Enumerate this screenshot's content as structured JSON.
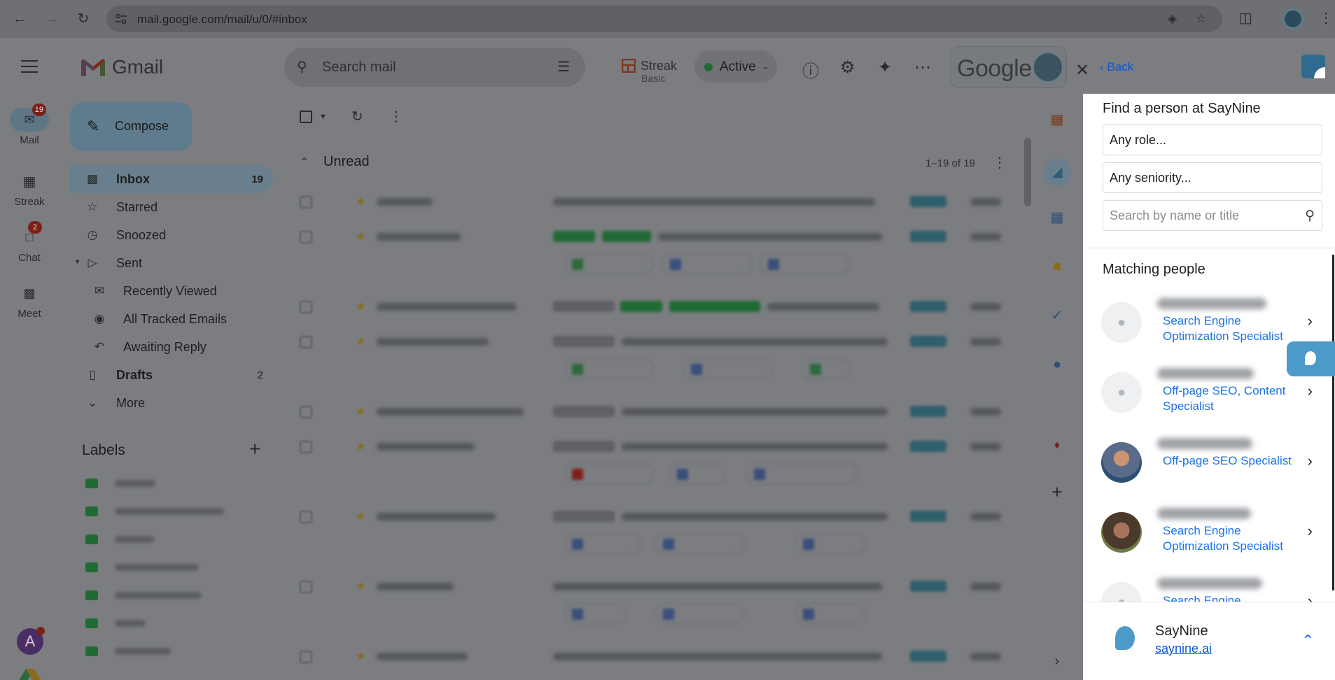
{
  "browser": {
    "url": "mail.google.com/mail/u/0/#inbox"
  },
  "rail": {
    "mail": {
      "label": "Mail",
      "badge": "19"
    },
    "streak": {
      "label": "Streak"
    },
    "chat": {
      "label": "Chat",
      "badge": "2"
    },
    "meet": {
      "label": "Meet"
    },
    "account_initial": "A"
  },
  "header": {
    "app_name": "Gmail",
    "search_placeholder": "Search mail",
    "streak_name": "Streak",
    "streak_plan": "Basic",
    "status": "Active",
    "google_label": "Google"
  },
  "sidebar": {
    "compose": "Compose",
    "items": [
      {
        "label": "Inbox",
        "count": "19"
      },
      {
        "label": "Starred",
        "count": ""
      },
      {
        "label": "Snoozed",
        "count": ""
      },
      {
        "label": "Sent",
        "count": ""
      },
      {
        "label": "Recently Viewed",
        "count": ""
      },
      {
        "label": "All Tracked Emails",
        "count": ""
      },
      {
        "label": "Awaiting Reply",
        "count": ""
      },
      {
        "label": "Drafts",
        "count": "2"
      },
      {
        "label": "More",
        "count": ""
      }
    ],
    "labels_title": "Labels"
  },
  "inbox": {
    "section_title": "Unread",
    "range": "1–19 of 19"
  },
  "panel": {
    "back": "Back",
    "find_title": "Find a person at SayNine",
    "role_field": "Any role...",
    "seniority_field": "Any seniority...",
    "search_placeholder": "Search by name or title",
    "matching_title": "Matching people",
    "people": [
      {
        "role": "Search Engine Optimization Specialist"
      },
      {
        "role": "Off-page SEO, Content Specialist"
      },
      {
        "role": "Off-page SEO Specialist"
      },
      {
        "role": "Search Engine Optimization Specialist"
      },
      {
        "role": "Search Engine"
      }
    ],
    "company_name": "SayNine",
    "company_link": "saynine.ai"
  },
  "colors": {
    "accent_blue": "#1a73e8",
    "link_blue": "#0b57d0",
    "saynine_blue": "#4c9ac9",
    "active_green": "#1f6b33"
  }
}
